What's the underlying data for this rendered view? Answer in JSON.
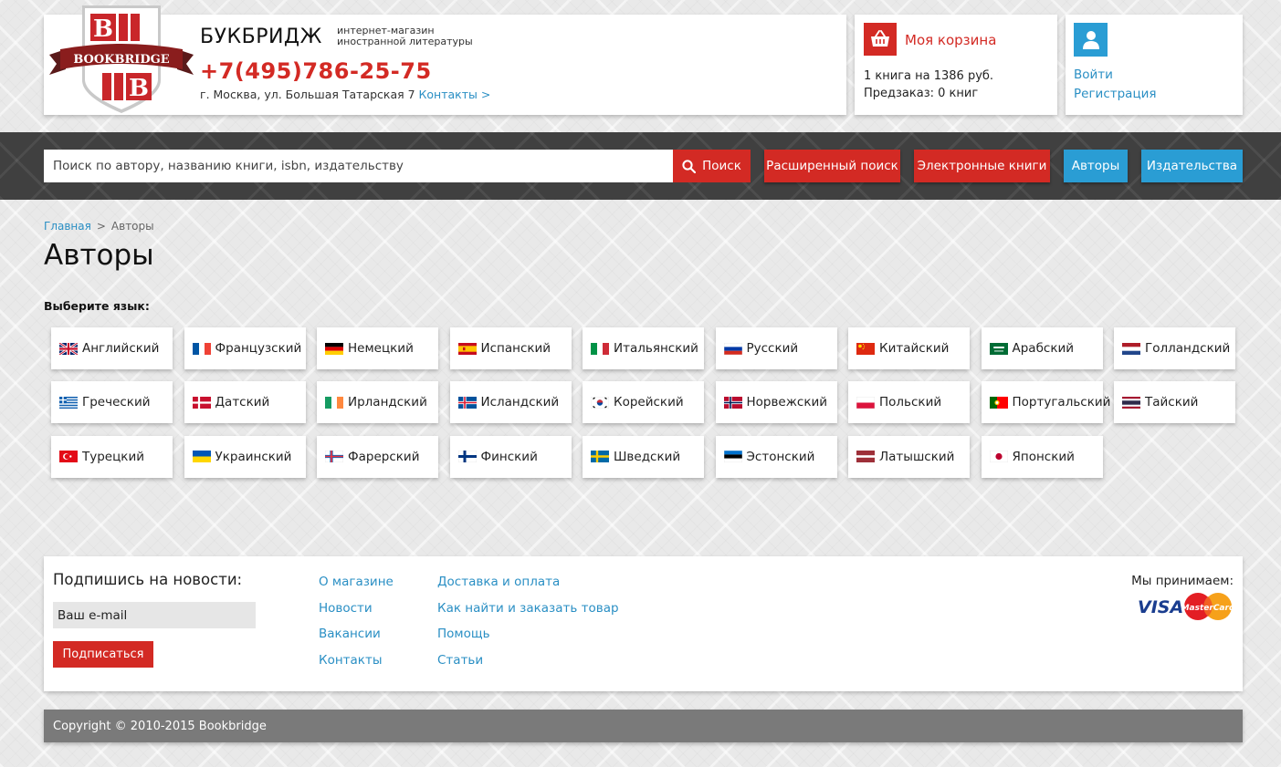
{
  "brand": {
    "logo_text": "BOOKBRIDGE",
    "name": "БУКБРИДЖ",
    "tagline_line1": "интернет-магазин",
    "tagline_line2": "иностранной литературы",
    "phone": "+7(495)786-25-75",
    "address": "г. Москва, ул. Большая Татарская 7",
    "contacts_link": "Контакты >"
  },
  "cart": {
    "icon": "basket-icon",
    "title": "Моя корзина",
    "summary": "1 книга на 1386 руб.",
    "preorder": "Предзаказ: 0 книг"
  },
  "user": {
    "icon": "user-icon",
    "login": "Войти",
    "register": "Регистрация"
  },
  "search": {
    "placeholder": "Поиск по автору, названию книги, isbn, издательству",
    "button": "Поиск",
    "advanced": "Расширенный поиск",
    "ebooks": "Электронные книги",
    "authors": "Авторы",
    "publishers": "Издательства"
  },
  "breadcrumb": {
    "home": "Главная",
    "separator": ">",
    "current": "Авторы"
  },
  "page": {
    "title": "Авторы",
    "language_prompt": "Выберите язык:"
  },
  "languages": [
    {
      "label": "Английский",
      "flag": "uk"
    },
    {
      "label": "Французский",
      "flag": "fr"
    },
    {
      "label": "Немецкий",
      "flag": "de"
    },
    {
      "label": "Испанский",
      "flag": "es"
    },
    {
      "label": "Итальянский",
      "flag": "it"
    },
    {
      "label": "Русский",
      "flag": "ru"
    },
    {
      "label": "Китайский",
      "flag": "cn"
    },
    {
      "label": "Арабский",
      "flag": "sa"
    },
    {
      "label": "Голландский",
      "flag": "nl"
    },
    {
      "label": "Греческий",
      "flag": "gr"
    },
    {
      "label": "Датский",
      "flag": "dk"
    },
    {
      "label": "Ирландский",
      "flag": "ie"
    },
    {
      "label": "Исландский",
      "flag": "is"
    },
    {
      "label": "Корейский",
      "flag": "kr"
    },
    {
      "label": "Норвежский",
      "flag": "no"
    },
    {
      "label": "Польский",
      "flag": "pl"
    },
    {
      "label": "Португальский",
      "flag": "pt"
    },
    {
      "label": "Тайский",
      "flag": "th"
    },
    {
      "label": "Турецкий",
      "flag": "tr"
    },
    {
      "label": "Украинский",
      "flag": "ua"
    },
    {
      "label": "Фарерский",
      "flag": "fo"
    },
    {
      "label": "Финский",
      "flag": "fi"
    },
    {
      "label": "Шведский",
      "flag": "se"
    },
    {
      "label": "Эстонский",
      "flag": "ee"
    },
    {
      "label": "Латышский",
      "flag": "lv"
    },
    {
      "label": "Японский",
      "flag": "jp"
    }
  ],
  "footer": {
    "subscribe_title": "Подпишись на новости:",
    "email_placeholder": "Ваш e-mail",
    "subscribe_button": "Подписаться",
    "links_col1": [
      "О магазине",
      "Новости",
      "Вакансии",
      "Контакты"
    ],
    "links_col2": [
      "Доставка и оплата",
      "Как найти и заказать товар",
      "Помощь",
      "Статьи"
    ],
    "accept_label": "Мы принимаем:",
    "payment_visa": "VISA",
    "payment_mastercard": "MasterCard",
    "copyright": "Copyright © 2010-2015 Bookbridge"
  },
  "colors": {
    "brand_red": "#d32a24",
    "link_blue": "#2a8fc4",
    "accent_blue": "#2a9dd4",
    "search_band": "#404040",
    "copyright_bar": "#7a7a7a"
  }
}
